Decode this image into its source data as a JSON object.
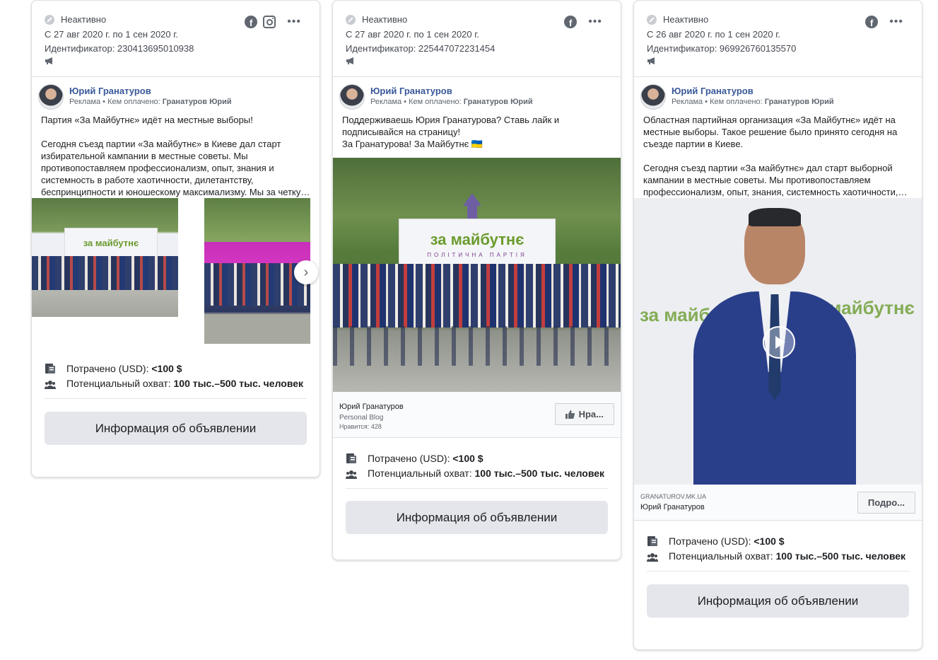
{
  "cards": [
    {
      "status": "Неактивно",
      "dates": "С 27 авг 2020 г. по 1 сен 2020 г.",
      "id_label": "Идентификатор: 230413695010938",
      "page_name": "Юрий Гранатуров",
      "ad_label": "Реклама",
      "paid_by_label": "Кем оплачено:",
      "paid_by": "Гранатуров Юрий",
      "text": "Партия «За Майбутнє» идёт на местные выборы!\n\nСегодня съезд партии «За майбутнє» в Киеве дал старт избирательной кампании в местные советы. Мы противопоставляем профессионализм, опыт, знания и системность в работе хаотичности, дилетантству, беспринципности и юношескому максимализму. Мы за четку…",
      "banner_text": "за майбутнє",
      "spent_label": "Потрачено (USD):",
      "spent_value": "<100 $",
      "reach_label": "Потенциальный охват:",
      "reach_value": "100 тыс.–500 тыс. человек",
      "info_button": "Информация об объявлении"
    },
    {
      "status": "Неактивно",
      "dates": "С 27 авг 2020 г. по 1 сен 2020 г.",
      "id_label": "Идентификатор: 225447072231454",
      "page_name": "Юрий Гранатуров",
      "ad_label": "Реклама",
      "paid_by_label": "Кем оплачено:",
      "paid_by": "Гранатуров Юрий",
      "text": "Поддерживаешь Юрия Гранатурова? Ставь лайк и подписывайся на страницу!\nЗа Гранатурова! За Майбутнє 🇺🇦",
      "banner_brand": "за майбутнє",
      "banner_sub": "ПОЛІТИЧНА ПАРТІЯ",
      "link_name": "Юрий Гранатуров",
      "link_category": "Personal Blog",
      "link_likes": "Нравится: 428",
      "cta": "Нра...",
      "spent_label": "Потрачено (USD):",
      "spent_value": "<100 $",
      "reach_label": "Потенциальный охват:",
      "reach_value": "100 тыс.–500 тыс. человек",
      "info_button": "Информация об объявлении"
    },
    {
      "status": "Неактивно",
      "dates": "С 26 авг 2020 г. по 1 сен 2020 г.",
      "id_label": "Идентификатор: 969926760135570",
      "page_name": "Юрий Гранатуров",
      "ad_label": "Реклама",
      "paid_by_label": "Кем оплачено:",
      "paid_by": "Гранатуров Юрий",
      "text": "Областная партийная организация «За Майбутнє» идёт на местные выборы. Такое решение было принято сегодня на съезде партии в Киеве.\n\nСегодня съезд партии «За майбутнє» дал старт выборной кампании в местные советы. Мы противопоставляем профессионализм, опыт, знания, системность хаотичности,…",
      "video_brand": "за майбутнє",
      "link_domain": "GRANATUROV.MK.UA",
      "link_name": "Юрий Гранатуров",
      "cta": "Подро...",
      "spent_label": "Потрачено (USD):",
      "spent_value": "<100 $",
      "reach_label": "Потенциальный охват:",
      "reach_value": "100 тыс.–500 тыс. человек",
      "info_button": "Информация об объявлении"
    }
  ],
  "icons": {
    "status": "inactive-icon",
    "platform_facebook": "facebook-icon",
    "platform_instagram": "instagram-icon",
    "more": "more-icon",
    "ad_type": "megaphone-icon",
    "spent": "money-icon",
    "reach": "people-icon",
    "carousel_next": "chevron-right-icon",
    "play": "play-icon",
    "like": "thumbs-up-icon"
  },
  "colors": {
    "link_blue": "#385898",
    "button_gray": "#e4e6eb",
    "brand_green": "#6b9c2f",
    "brand_purple": "#7d3d8f"
  }
}
